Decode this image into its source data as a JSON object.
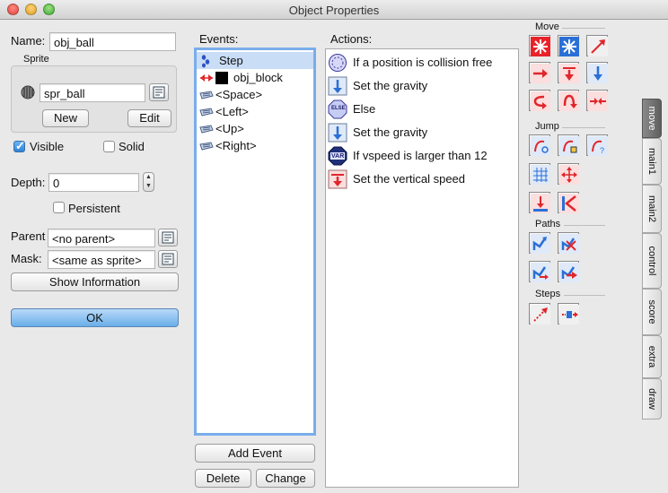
{
  "window": {
    "title": "Object Properties"
  },
  "props": {
    "name_label": "Name:",
    "name_value": "obj_ball",
    "sprite_group": "Sprite",
    "sprite_value": "spr_ball",
    "new_label": "New",
    "edit_label": "Edit",
    "visible_label": "Visible",
    "visible_checked": true,
    "solid_label": "Solid",
    "solid_checked": false,
    "depth_label": "Depth:",
    "depth_value": "0",
    "persistent_label": "Persistent",
    "persistent_checked": false,
    "parent_label": "Parent",
    "parent_value": "<no parent>",
    "mask_label": "Mask:",
    "mask_value": "<same as sprite>",
    "show_info_label": "Show Information",
    "ok_label": "OK"
  },
  "events": {
    "header": "Events:",
    "items": [
      {
        "label": "Step",
        "icon": "step-icon",
        "selected": true
      },
      {
        "label": "obj_block",
        "icon": "collision-icon",
        "selected": false
      },
      {
        "label": "<Space>",
        "icon": "keyboard-icon",
        "selected": false
      },
      {
        "label": "<Left>",
        "icon": "keyboard-icon",
        "selected": false
      },
      {
        "label": "<Up>",
        "icon": "keyboard-icon",
        "selected": false
      },
      {
        "label": "<Right>",
        "icon": "keyboard-icon",
        "selected": false
      }
    ],
    "add_label": "Add Event",
    "delete_label": "Delete",
    "change_label": "Change"
  },
  "actions": {
    "header": "Actions:",
    "items": [
      {
        "label": "If a position is collision free",
        "icon": "collision-free-icon"
      },
      {
        "label": "Set the gravity",
        "icon": "gravity-icon"
      },
      {
        "label": "Else",
        "icon": "else-icon",
        "badge": "ELSE"
      },
      {
        "label": "Set the gravity",
        "icon": "gravity-icon"
      },
      {
        "label": "If vspeed is larger than 12",
        "icon": "var-icon",
        "badge": "VAR"
      },
      {
        "label": "Set the vertical speed",
        "icon": "vspeed-icon"
      }
    ]
  },
  "library": {
    "sections": [
      "Move",
      "Jump",
      "Paths",
      "Steps"
    ],
    "tabs": [
      {
        "label": "move",
        "active": true
      },
      {
        "label": "main1",
        "active": false
      },
      {
        "label": "main2",
        "active": false
      },
      {
        "label": "control",
        "active": false
      },
      {
        "label": "score",
        "active": false
      },
      {
        "label": "extra",
        "active": false
      },
      {
        "label": "draw",
        "active": false
      }
    ]
  },
  "colors": {
    "accent_blue": "#79adea",
    "selection": "#c9ddf6",
    "ok_button": "#6aaee9",
    "action_red": "#e0262b",
    "action_blue": "#2a6fd6"
  }
}
